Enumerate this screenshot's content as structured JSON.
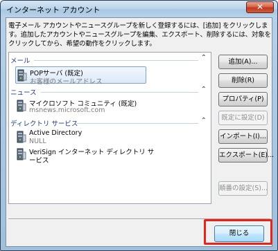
{
  "window": {
    "title": "インターネット アカウント",
    "close_glyph": "✕"
  },
  "description": "電子メール アカウントやニュースグループを新しく登録するには、[追加] をクリックします。追加したアカウントやニュースグループを編集、エクスポート、削除するには、対象をクリックしてから、希望の動作をクリックします。",
  "groups": [
    {
      "label": "メール",
      "items": [
        {
          "name": "POPサーバ (既定)",
          "detail": "お客様のメールアドレス",
          "selected": true
        }
      ]
    },
    {
      "label": "ニュース",
      "items": [
        {
          "name": "マイクロソフト コミュニティ (既定)",
          "detail": "msnews.microsoft.com",
          "selected": false
        }
      ]
    },
    {
      "label": "ディレクトリ サービス",
      "items": [
        {
          "name": "Active Directory",
          "detail": "NULL",
          "selected": false
        },
        {
          "name": "VeriSign インターネット ディレクトリ サ",
          "detail": "ービス",
          "selected": false
        }
      ]
    }
  ],
  "buttons": {
    "add": "追加(A)...",
    "remove": "削除(R)",
    "properties": "プロパティ(P)",
    "set_default": "既定に設定(D)",
    "import": "インポート(I)...",
    "export": "エクスポート(E)...",
    "order": "順番の設定(S)...",
    "close": "閉じる"
  },
  "colors": {
    "highlight": "#e8231c",
    "group_header": "#1e3b8a"
  }
}
